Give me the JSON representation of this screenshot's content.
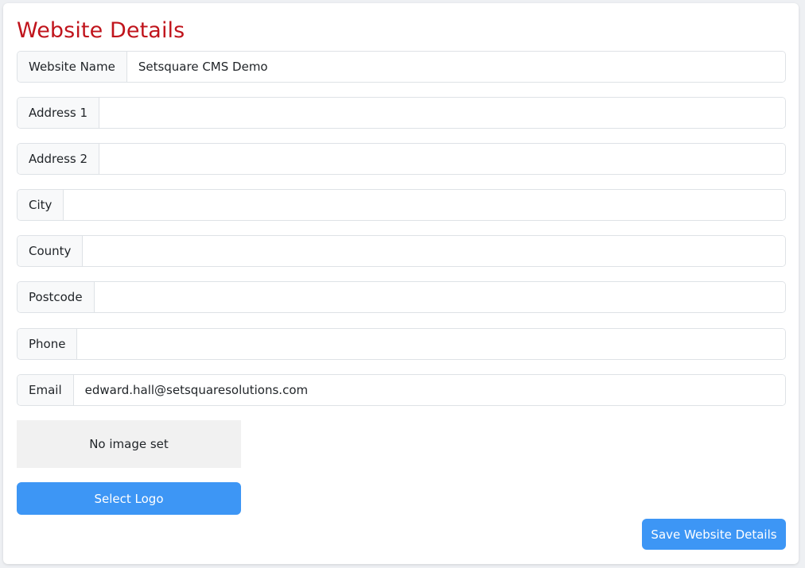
{
  "page": {
    "title": "Website Details"
  },
  "fields": [
    {
      "label": "Website Name",
      "value": "Setsquare CMS Demo",
      "placeholder": ""
    },
    {
      "label": "Address 1",
      "value": "",
      "placeholder": ""
    },
    {
      "label": "Address 2",
      "value": "",
      "placeholder": ""
    },
    {
      "label": "City",
      "value": "",
      "placeholder": ""
    },
    {
      "label": "County",
      "value": "",
      "placeholder": ""
    },
    {
      "label": "Postcode",
      "value": "",
      "placeholder": ""
    },
    {
      "label": "Phone",
      "value": "",
      "placeholder": ""
    },
    {
      "label": "Email",
      "value": "edward.hall@setsquaresolutions.com",
      "placeholder": ""
    }
  ],
  "logo": {
    "empty_text": "No image set",
    "select_label": "Select Logo"
  },
  "actions": {
    "save_label": "Save Website Details"
  },
  "colors": {
    "title": "#c0141c",
    "primary_button": "#3d96f5",
    "label_background": "#f8f9fa",
    "logo_placeholder_background": "#f1f1f1"
  }
}
